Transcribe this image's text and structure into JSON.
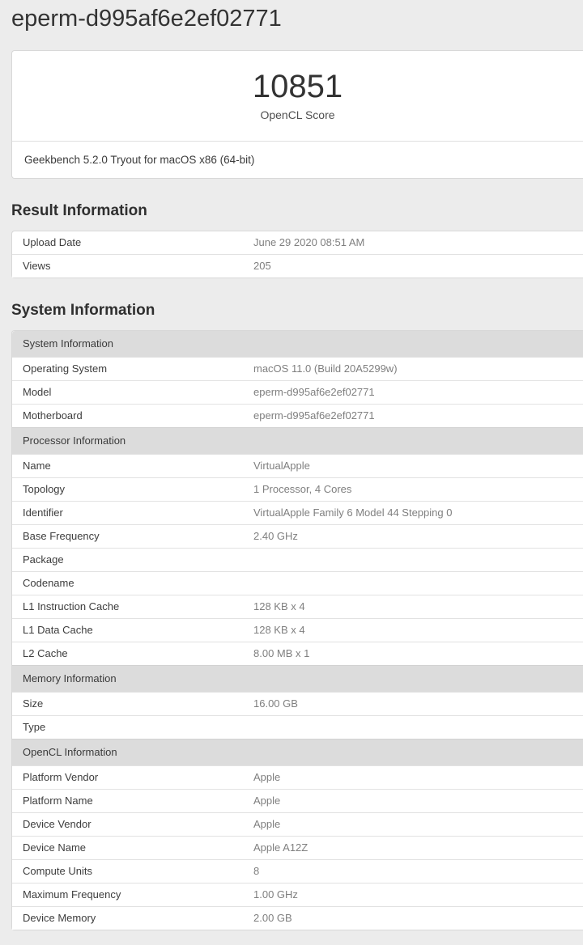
{
  "page": {
    "title": "eperm-d995af6e2ef02771"
  },
  "score_card": {
    "score": "10851",
    "score_label": "OpenCL Score",
    "footer": "Geekbench 5.2.0 Tryout for macOS x86 (64-bit)"
  },
  "result_information": {
    "heading": "Result Information",
    "rows": [
      {
        "label": "Upload Date",
        "value": "June 29 2020 08:51 AM"
      },
      {
        "label": "Views",
        "value": "205"
      }
    ]
  },
  "system_information": {
    "heading": "System Information",
    "groups": [
      {
        "header": "System Information",
        "rows": [
          {
            "label": "Operating System",
            "value": "macOS 11.0 (Build 20A5299w)"
          },
          {
            "label": "Model",
            "value": "eperm-d995af6e2ef02771"
          },
          {
            "label": "Motherboard",
            "value": "eperm-d995af6e2ef02771"
          }
        ]
      },
      {
        "header": "Processor Information",
        "rows": [
          {
            "label": "Name",
            "value": "VirtualApple"
          },
          {
            "label": "Topology",
            "value": "1 Processor, 4 Cores"
          },
          {
            "label": "Identifier",
            "value": "VirtualApple Family 6 Model 44 Stepping 0"
          },
          {
            "label": "Base Frequency",
            "value": "2.40 GHz"
          },
          {
            "label": "Package",
            "value": ""
          },
          {
            "label": "Codename",
            "value": ""
          },
          {
            "label": "L1 Instruction Cache",
            "value": "128 KB x 4"
          },
          {
            "label": "L1 Data Cache",
            "value": "128 KB x 4"
          },
          {
            "label": "L2 Cache",
            "value": "8.00 MB x 1"
          }
        ]
      },
      {
        "header": "Memory Information",
        "rows": [
          {
            "label": "Size",
            "value": "16.00 GB"
          },
          {
            "label": "Type",
            "value": ""
          }
        ]
      },
      {
        "header": "OpenCL Information",
        "rows": [
          {
            "label": "Platform Vendor",
            "value": "Apple"
          },
          {
            "label": "Platform Name",
            "value": "Apple"
          },
          {
            "label": "Device Vendor",
            "value": "Apple"
          },
          {
            "label": "Device Name",
            "value": "Apple A12Z"
          },
          {
            "label": "Compute Units",
            "value": "8"
          },
          {
            "label": "Maximum Frequency",
            "value": "1.00 GHz"
          },
          {
            "label": "Device Memory",
            "value": "2.00 GB"
          }
        ]
      }
    ]
  },
  "colors": {
    "page_background": "#ececec",
    "card_background": "#ffffff",
    "card_border": "#d8d8d8",
    "group_header_background": "#dcdcdc",
    "label_text": "#3d3d3d",
    "value_text": "#7f7f7f",
    "heading_text": "#2f2f2f"
  }
}
